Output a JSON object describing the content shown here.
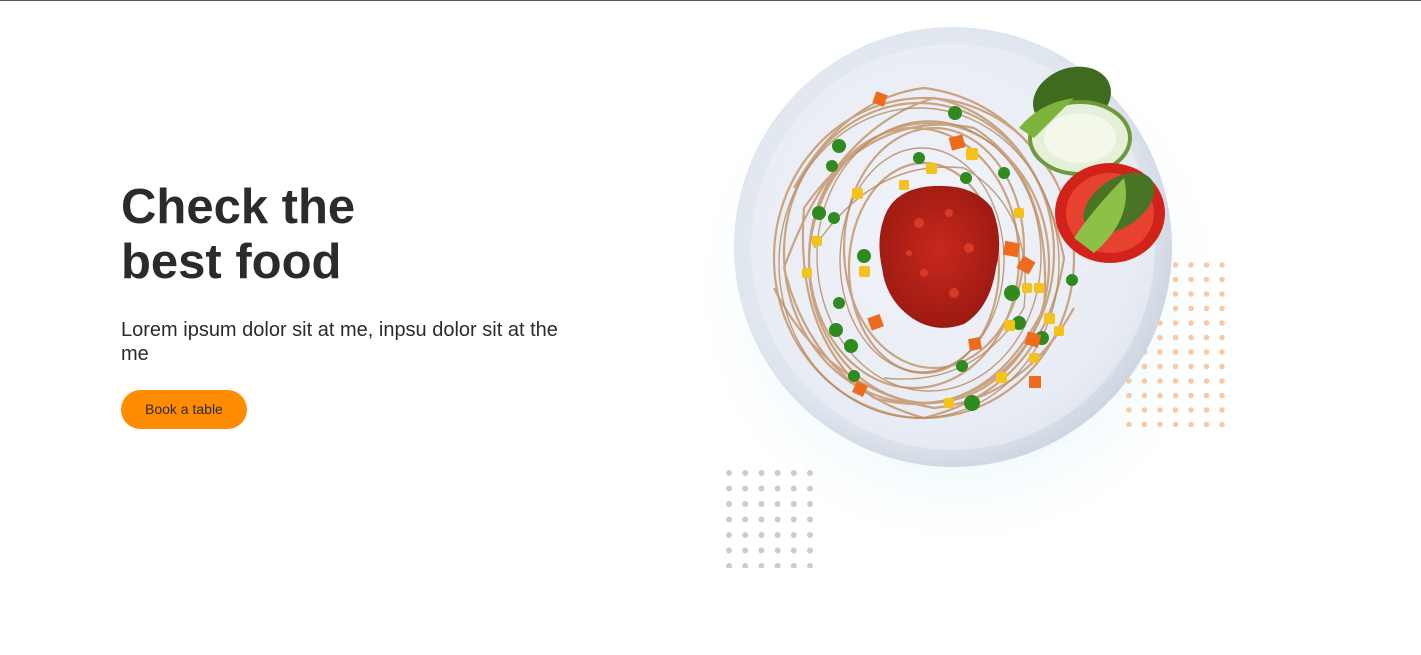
{
  "hero": {
    "headline": "Check the\nbest food",
    "subtitle": "Lorem ipsum dolor sit at me, inpsu dolor sit at the me",
    "cta_label": "Book a table"
  },
  "image": {
    "subject": "plate of spaghetti with tomato sauce, peas, corn, carrots and side salad"
  },
  "colors": {
    "accent": "#ff8c00",
    "text": "#2b2b2b",
    "dots_gray": "#c9cdd1",
    "dots_orange": "#f9c9a2"
  }
}
